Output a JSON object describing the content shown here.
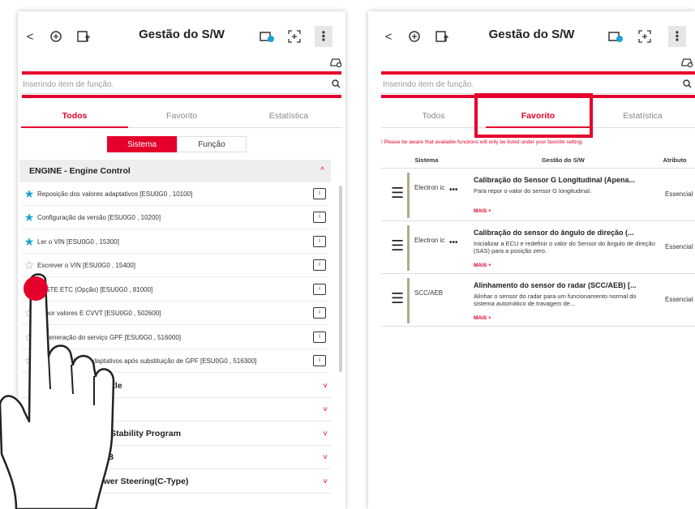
{
  "left": {
    "header": {
      "back_glyph": "<",
      "title": "Gestão do S/W",
      "menu_glyph": "⋮"
    },
    "search": {
      "placeholder": "Inserindo item de função.",
      "icon": "search-icon"
    },
    "tabs": [
      {
        "label": "Todos",
        "active": true
      },
      {
        "label": "Favorito",
        "active": false
      },
      {
        "label": "Estatística",
        "active": false
      }
    ],
    "segment": {
      "sistema": "Sistema",
      "funcao": "Função"
    },
    "group": {
      "title": "ENGINE - Engine Control",
      "chevron": "^"
    },
    "functions": [
      {
        "text": "Reposição dos valores adaptativos [ESU0G0 , 10100]",
        "fav": true
      },
      {
        "text": "Configuração da versão [ESU0G0 , 10200]",
        "fav": true
      },
      {
        "text": "Ler o VIN [ESU0G0 , 15300]",
        "fav": true
      },
      {
        "text": "Escrever o VIN [ESU0G0 , 15400]",
        "fav": false
      },
      {
        "text": "TESTE ETC (Opção) [ESU0G0 , 81000]",
        "fav": false
      },
      {
        "text": "Repor valores E CVVT [ESU0G0 , 502600]",
        "fav": false
      },
      {
        "text": "Regeneração do serviço GPF [ESU0G0 , 516000]",
        "fav": false
      },
      {
        "text": "alores adaptativos após substituição de GPF [ESU0G0 , 516300]",
        "fav": false
      }
    ],
    "collapsed": [
      {
        "label": "nsaxle"
      },
      {
        "label": ""
      },
      {
        "label": "nic Stability Program"
      },
      {
        "label": "AEB"
      },
      {
        "label": "EPS - Mo...    ven Power Steering(C-Type)"
      }
    ],
    "chevron_down": "˅",
    "star_full": "★",
    "star_empty": "☆"
  },
  "right": {
    "header": {
      "back_glyph": "<",
      "title": "Gestão do S/W",
      "menu_glyph": "⋮"
    },
    "search": {
      "placeholder": "Inserindo item de função.",
      "icon": "search-icon"
    },
    "tabs": [
      {
        "label": "Todos",
        "active": false
      },
      {
        "label": "Favorito",
        "active": true
      },
      {
        "label": "Estatística",
        "active": false
      }
    ],
    "notice": "! Please be aware that available functions will only be listed under your favorite setting.",
    "columns": {
      "sistema": "Sistema",
      "gestao": "Gestão do S/W",
      "atributo": "Atributo"
    },
    "rows": [
      {
        "sistema": "Electron ic",
        "title": "Calibração do Sensor G Longitudinal (Apena...",
        "desc": "Para repor o valor do sensor G longitudinal.",
        "more": "MAIS +",
        "atributo": "Essencial"
      },
      {
        "sistema": "Electron ic",
        "title": "Calibração do sensor do ângulo de direção (...",
        "desc": "Inicializar a ECU e redefinir o valor do Sensor do ângulo de direção (SAS) para a posição zero.",
        "more": "MAIS +",
        "atributo": "Essencial"
      },
      {
        "sistema": "SCC/AEB",
        "title": "Alinhamento do sensor do radar (SCC/AEB) [...",
        "desc": "Alinhar o sensor do radar para um funcionamento normal do sistema automático de travagem de...",
        "more": "MAIS +",
        "atributo": "Essencial"
      }
    ],
    "dots": "•••",
    "hamburger": "☰"
  },
  "colors": {
    "accent": "#e4002b",
    "star": "#1aa3d9",
    "row_bar": "#b5a98a"
  }
}
